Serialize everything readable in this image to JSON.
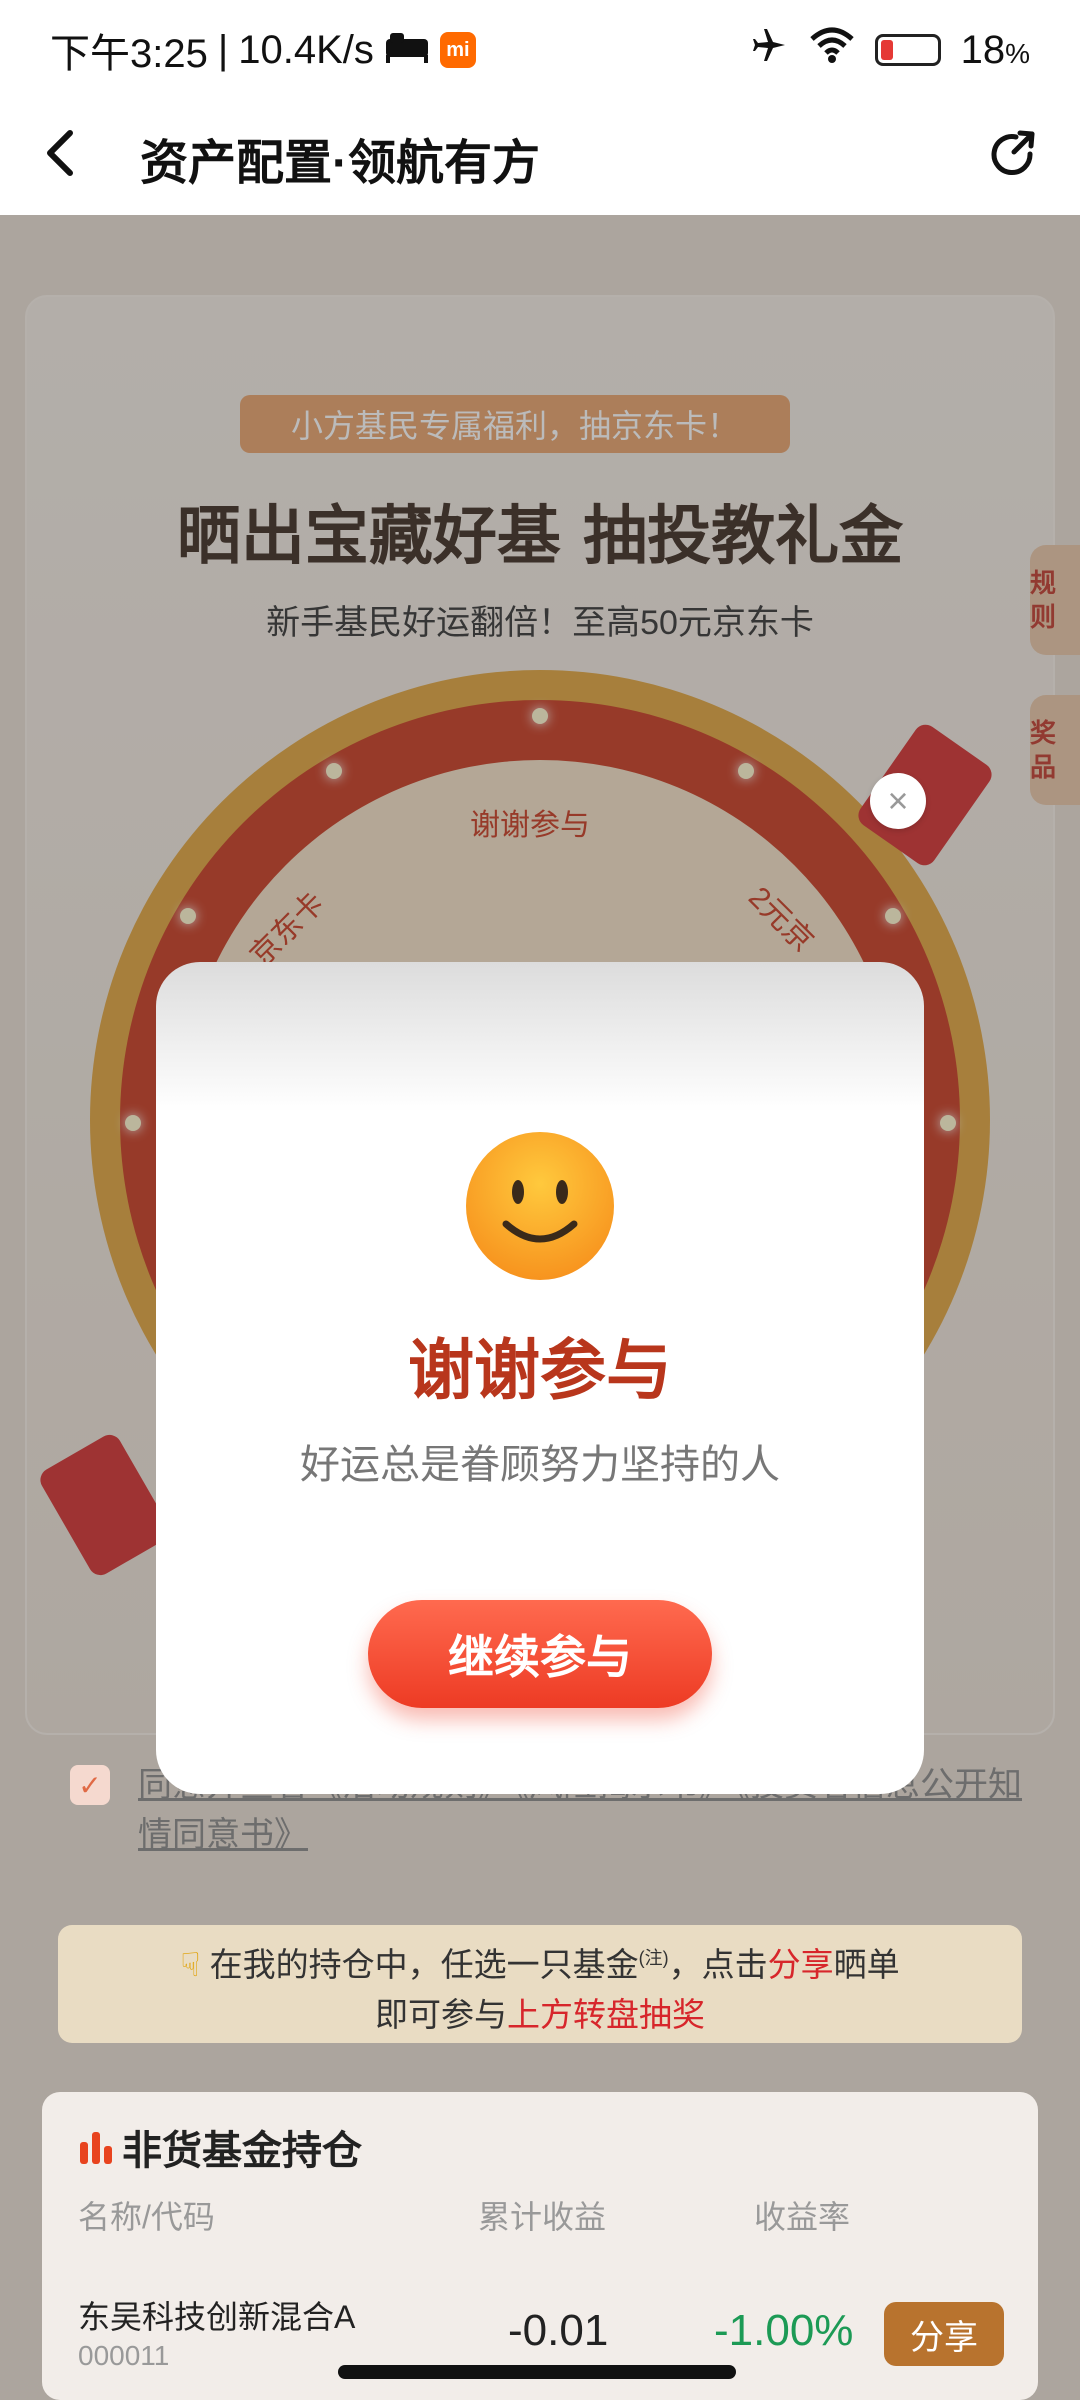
{
  "status_bar": {
    "time": "下午3:25",
    "network_speed": "10.4K/s",
    "battery": "18",
    "battery_unit": "%"
  },
  "nav": {
    "title": "资产配置·领航有方"
  },
  "promo": {
    "pill": "小方基民专属福利，抽京东卡！",
    "headline": "晒出宝藏好基  抽投教礼金",
    "subline": "新手基民好运翻倍！至高50元京东卡",
    "rules_tab": "规则",
    "prize_tab": "奖品",
    "segments": [
      "谢谢参与",
      "2元京",
      "京东卡"
    ]
  },
  "consent": {
    "text": "同意并查看《活动规则》《风险揭示书》《投资者信息公开知情同意书》"
  },
  "notice": {
    "line1_prefix": "在我的持仓中，任选一只基金",
    "line1_note": "(注)",
    "line1_mid": "，点击",
    "line1_red": "分享",
    "line1_suffix": "晒单",
    "line2_prefix": "即可参与",
    "line2_red": "上方转盘抽奖"
  },
  "holdings": {
    "title": "非货基金持仓",
    "columns": [
      "名称/代码",
      "累计收益",
      "收益率"
    ],
    "rows": [
      {
        "name": "东吴科技创新混合A",
        "code": "000011",
        "profit": "-0.01",
        "rate": "-1.00%",
        "action": "分享"
      }
    ]
  },
  "modal": {
    "title": "谢谢参与",
    "subtitle": "好运总是眷顾努力坚持的人",
    "button": "继续参与"
  },
  "colors": {
    "accent_red": "#ed3b24",
    "title_red": "#b8361c",
    "negative_green": "#1c9a55"
  }
}
